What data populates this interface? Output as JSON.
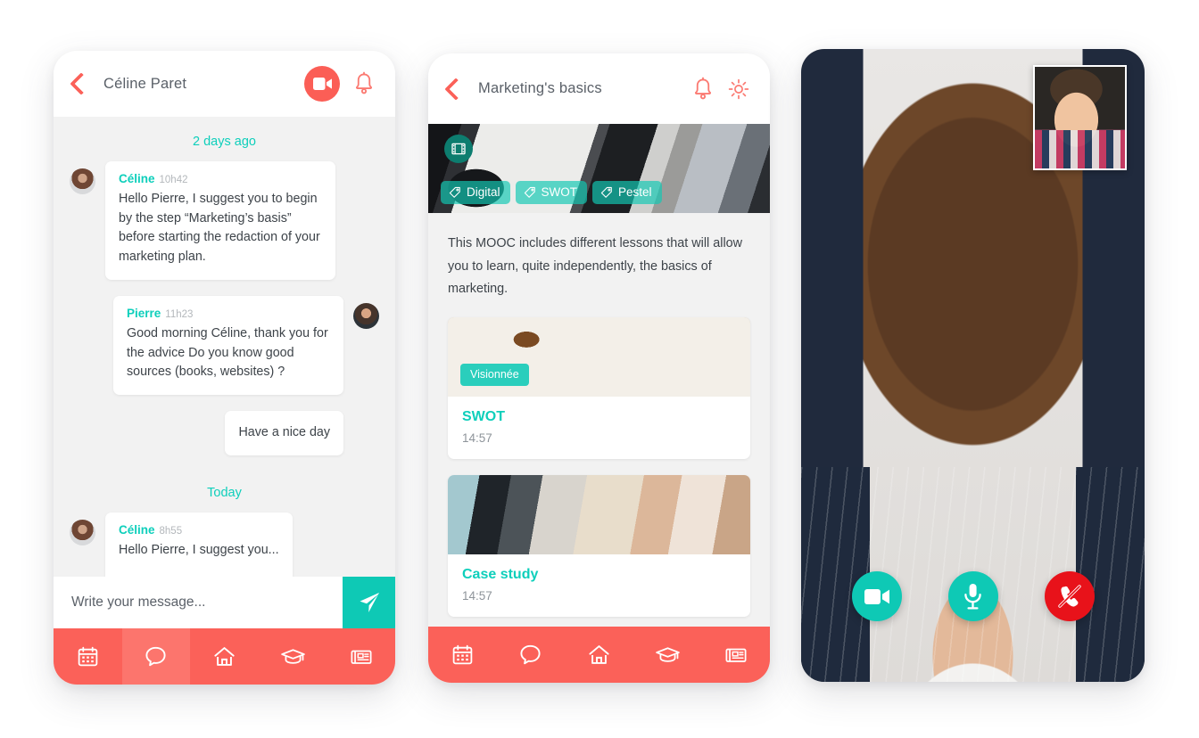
{
  "chat_panel": {
    "header": {
      "back_icon": "back-chevron-icon",
      "title": "Céline Paret",
      "video_call_icon": "video-camera-icon",
      "bell_icon": "bell-icon"
    },
    "date_separators": {
      "first": "2 days ago",
      "second": "Today"
    },
    "messages": [
      {
        "sender": "Céline",
        "time": "10h42",
        "text": "Hello Pierre, I suggest you to begin by the step “Marketing’s basis” before starting the redaction of your marketing plan.",
        "side": "left"
      },
      {
        "sender": "Pierre",
        "time": "11h23",
        "text": "Good morning Céline, thank you for the advice Do you know good sources (books, websites) ?",
        "side": "right"
      },
      {
        "sender": "",
        "time": "",
        "text": "Have a nice day",
        "side": "right"
      },
      {
        "sender": "Céline",
        "time": "8h55",
        "text": "Hello Pierre, I suggest you...",
        "side": "left"
      }
    ],
    "compose": {
      "placeholder": "Write your message...",
      "value": "",
      "send_icon": "send-paper-plane-icon"
    },
    "tabbar": [
      {
        "icon": "calendar-icon",
        "active": false
      },
      {
        "icon": "chat-bubble-icon",
        "active": true
      },
      {
        "icon": "home-icon",
        "active": false
      },
      {
        "icon": "graduation-cap-icon",
        "active": false
      },
      {
        "icon": "news-icon",
        "active": false
      }
    ]
  },
  "course_panel": {
    "header": {
      "back_icon": "back-chevron-icon",
      "title": "Marketing's basics",
      "bell_icon": "bell-icon",
      "settings_icon": "gear-icon"
    },
    "hero": {
      "play_badge_icon": "film-reel-icon",
      "tags": [
        "Digital",
        "SWOT",
        "Pestel"
      ],
      "tag_icon": "tag-icon"
    },
    "description": "This MOOC includes different lessons that will allow you to learn, quite independently, the basics of marketing.",
    "lessons": [
      {
        "name": "SWOT",
        "duration": "14:57",
        "badge": "Visionnée"
      },
      {
        "name": "Case study",
        "duration": "14:57",
        "badge": ""
      }
    ],
    "tabbar": [
      {
        "icon": "calendar-icon",
        "active": false
      },
      {
        "icon": "chat-bubble-icon",
        "active": false
      },
      {
        "icon": "home-icon",
        "active": false
      },
      {
        "icon": "graduation-cap-icon",
        "active": false
      },
      {
        "icon": "news-icon",
        "active": false
      }
    ]
  },
  "video_panel": {
    "remote_participant": "remote-video-feed",
    "self_view": "self-video-thumbnail",
    "controls": [
      {
        "icon": "video-camera-icon",
        "state": "on",
        "color": "#0ec9b5"
      },
      {
        "icon": "microphone-icon",
        "state": "on",
        "color": "#0ec9b5"
      },
      {
        "icon": "hang-up-icon",
        "state": "end-call",
        "color": "#e8121a"
      }
    ]
  },
  "theme": {
    "coral": "#fb6159",
    "teal": "#0ec9b5",
    "teal_text": "#0ecfbb",
    "red": "#e8121a",
    "panel_bg": "#f2f2f2",
    "text_dark": "#3d4349",
    "text_muted": "#8e949a"
  }
}
